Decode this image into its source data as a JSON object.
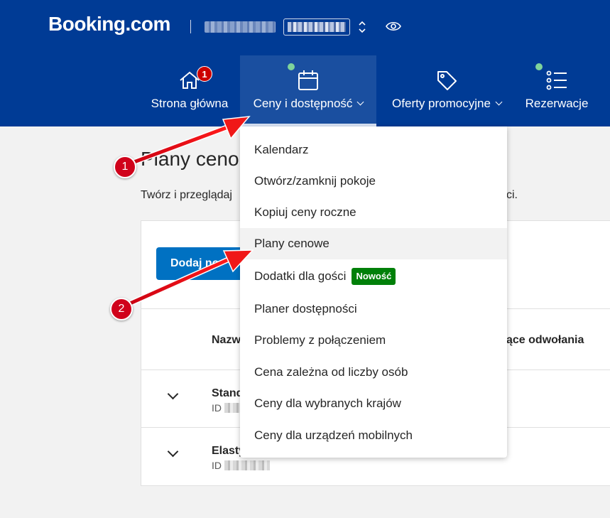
{
  "header": {
    "logo": "Booking.com",
    "home_badge": "1"
  },
  "nav": {
    "home": "Strona główna",
    "rates": "Ceny i dostępność",
    "promos": "Oferty promocyjne",
    "reservations": "Rezerwacje"
  },
  "main": {
    "title": "Plany ceno",
    "description": "Twórz i przeglądaj",
    "description_end": "ci.",
    "add_button": "Dodaj no",
    "table": {
      "col_name": "Nazw",
      "col_cancel": "ące odwołania"
    },
    "plans": [
      {
        "name": "Stand",
        "id_label": "ID"
      },
      {
        "name": "Elasty",
        "id_label": "ID"
      }
    ]
  },
  "dropdown": {
    "items": [
      "Kalendarz",
      "Otwórz/zamknij pokoje",
      "Kopiuj ceny roczne",
      "Plany cenowe",
      "Dodatki dla gości",
      "Planer dostępności",
      "Problemy z połączeniem",
      "Cena zależna od liczby osób",
      "Ceny dla wybranych krajów",
      "Ceny dla urządzeń mobilnych"
    ],
    "new_badge": "Nowość",
    "highlighted": "Plany cenowe"
  },
  "annotations": {
    "step1": "1",
    "step2": "2"
  },
  "colors": {
    "brand": "#003b95",
    "primary_button": "#0071c2",
    "new_badge": "#008009",
    "annotation": "#d0021b"
  }
}
